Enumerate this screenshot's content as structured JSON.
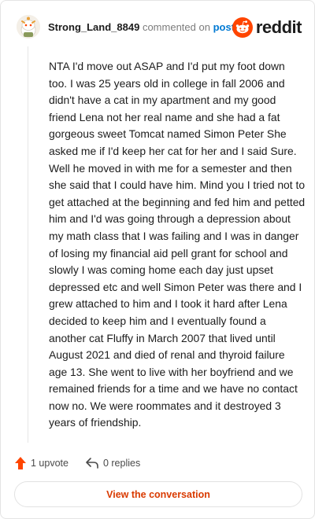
{
  "header": {
    "username": "Strong_Land_8849",
    "commented_text": "commented on",
    "post_link": "post",
    "brand": "reddit"
  },
  "comment": {
    "body": "NTA I'd move out ASAP and I'd put my foot down too. I was 25 years old in college in fall 2006 and didn't have a cat in my apartment and my good friend Lena not her real name and she had a fat gorgeous sweet Tomcat named Simon Peter She asked me if I'd keep her cat for her and I said Sure. Well he moved in with me for a semester and then she said that I could have him. Mind you I tried not to get attached at the beginning and fed him and petted him and I'd was going through a depression about my math class that I was failing and I was in danger of losing my financial aid pell grant for school and slowly I was coming home each day just upset depressed etc and well Simon Peter was there and I grew attached to him and I took it hard after Lena decided to keep him and I eventually found a another cat Fluffy in March 2007 that lived until August 2021 and died of renal and thyroid failure age 13. She went to live with her boyfriend and we remained friends for a time and we have no contact now no. We were roommates and it destroyed 3 years of friendship."
  },
  "actions": {
    "upvotes": "1 upvote",
    "replies": "0 replies"
  },
  "footer": {
    "view_button": "View the conversation"
  },
  "colors": {
    "brand_orange": "#FF4500",
    "link_blue": "#0079D3",
    "button_text": "#D93A00"
  },
  "icons": [
    "snoo-avatar-icon",
    "reddit-logo-icon",
    "upvote-arrow-icon",
    "reply-arrow-icon"
  ]
}
